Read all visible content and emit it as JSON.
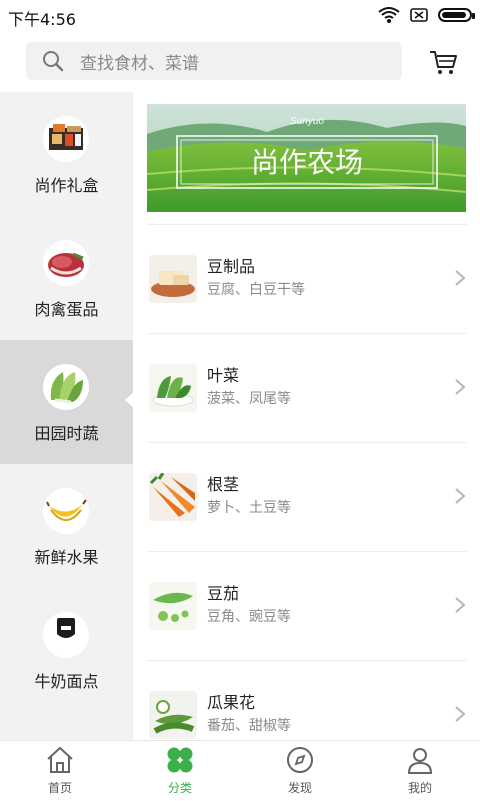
{
  "status": {
    "time": "下午4:56"
  },
  "search": {
    "placeholder": "查找食材、菜谱"
  },
  "sidebar": {
    "items": [
      {
        "label": "尚作礼盒",
        "icon": "gift-box-image"
      },
      {
        "label": "肉禽蛋品",
        "icon": "meat-image"
      },
      {
        "label": "田园时蔬",
        "icon": "vegetable-image",
        "active": true
      },
      {
        "label": "新鲜水果",
        "icon": "banana-image"
      },
      {
        "label": "牛奶面点",
        "icon": "milk-image"
      }
    ]
  },
  "banner": {
    "brand": "Sunyuo",
    "title": "尚作农场"
  },
  "categories": [
    {
      "title": "豆制品",
      "subtitle": "豆腐、白豆干等",
      "icon": "tofu-image"
    },
    {
      "title": "叶菜",
      "subtitle": "菠菜、凤尾等",
      "icon": "leafy-greens-image"
    },
    {
      "title": "根茎",
      "subtitle": "萝卜、土豆等",
      "icon": "carrot-image"
    },
    {
      "title": "豆茄",
      "subtitle": "豆角、豌豆等",
      "icon": "pea-image"
    },
    {
      "title": "瓜果花",
      "subtitle": "番茄、甜椒等",
      "icon": "okra-image"
    }
  ],
  "tabbar": {
    "items": [
      {
        "label": "首页",
        "icon": "home-icon"
      },
      {
        "label": "分类",
        "icon": "category-icon",
        "active": true
      },
      {
        "label": "发现",
        "icon": "compass-icon"
      },
      {
        "label": "我的",
        "icon": "user-icon"
      }
    ]
  },
  "colors": {
    "accent": "#3bb04a",
    "sidebar_bg": "#f2f2f2",
    "sidebar_active": "#d9d9d9"
  }
}
